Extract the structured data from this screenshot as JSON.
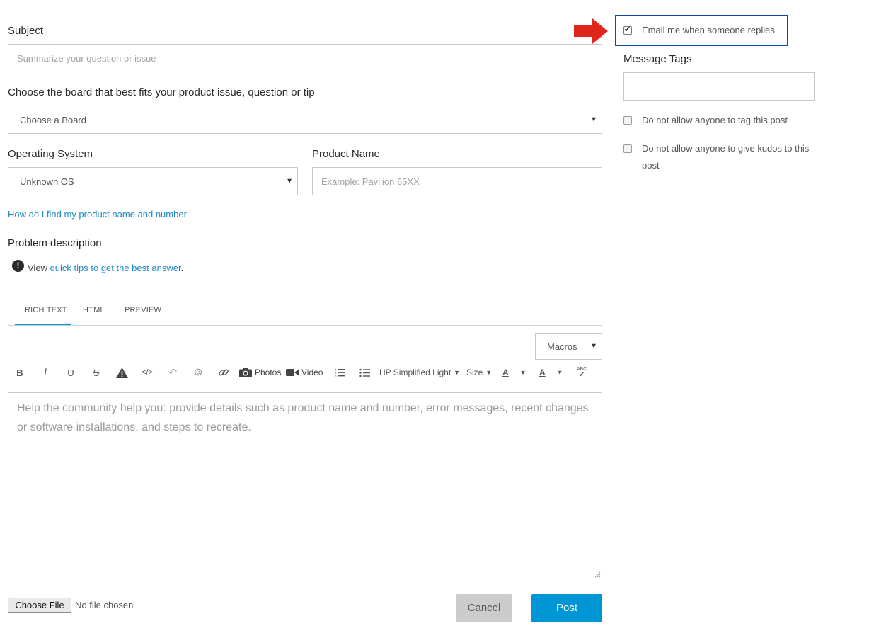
{
  "subject": {
    "label": "Subject",
    "placeholder": "Summarize your question or issue"
  },
  "board": {
    "label": "Choose the board that best fits your product issue, question or tip",
    "value": "Choose a Board"
  },
  "os": {
    "label": "Operating System",
    "value": "Unknown OS"
  },
  "product": {
    "label": "Product Name",
    "placeholder": "Example: Pavilion 65XX"
  },
  "help_link": "How do I find my product name and number",
  "problem": {
    "label": "Problem description",
    "tips_prefix": "View ",
    "tips_link": "quick tips to get the best answer",
    "tips_suffix": "."
  },
  "editor": {
    "tabs": [
      "RICH TEXT",
      "HTML",
      "PREVIEW"
    ],
    "active_tab": "RICH TEXT",
    "macros": "Macros",
    "toolbar": {
      "bold": "B",
      "italic": "I",
      "underline": "U",
      "strike": "S",
      "photos": "Photos",
      "video": "Video",
      "font": "HP Simplified Light",
      "size": "Size",
      "text_color": "A",
      "bg_color": "A",
      "spell": "ABC"
    },
    "placeholder": "Help the community help you: provide details such as product name and number, error messages, recent changes or software installations, and steps to recreate."
  },
  "file": {
    "button": "Choose File",
    "status": "No file chosen"
  },
  "actions": {
    "cancel": "Cancel",
    "post": "Post"
  },
  "sidebar": {
    "email_label": "Email me when someone replies",
    "email_checked": true,
    "tags_label": "Message Tags",
    "no_tag_label": "Do not allow anyone to tag this post",
    "no_kudos_label": "Do not allow anyone to give kudos to this post"
  },
  "colors": {
    "accent": "#0096d6",
    "link": "#1e87c6",
    "highlight_border": "#0a4aa8",
    "arrow": "#e0251b",
    "cancel_bg": "#cccccc"
  }
}
